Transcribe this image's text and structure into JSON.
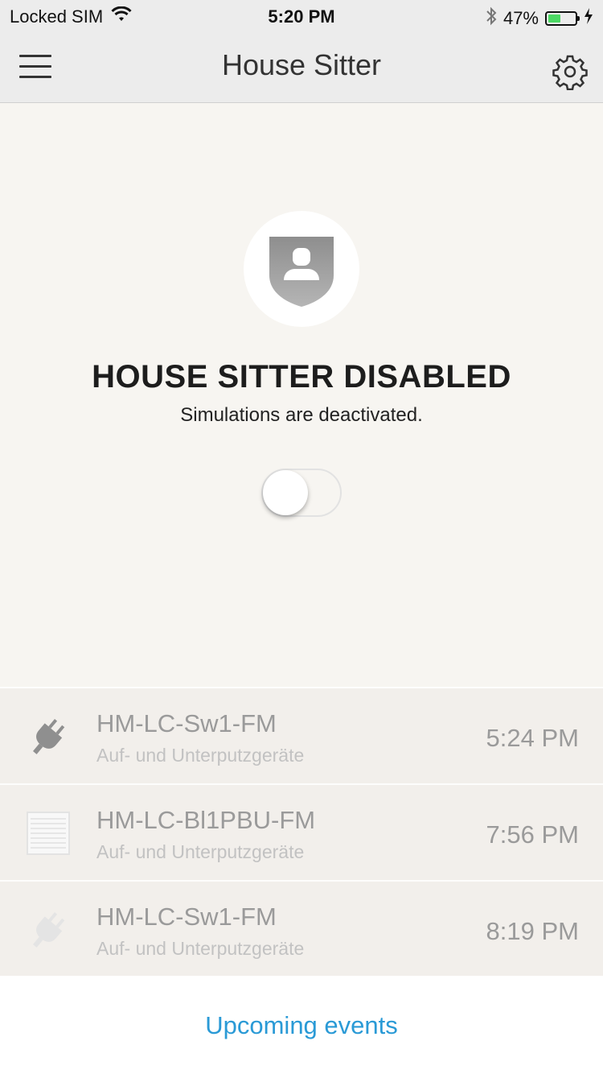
{
  "status_bar": {
    "carrier": "Locked SIM",
    "time": "5:20 PM",
    "battery_percent": "47%",
    "battery_level": 0.47,
    "icons": [
      "wifi-icon",
      "bluetooth-icon",
      "battery-icon",
      "charging-icon"
    ]
  },
  "nav": {
    "title": "House Sitter",
    "menu_icon": "hamburger-icon",
    "settings_icon": "gear-icon"
  },
  "hero": {
    "icon": "shield-person-icon",
    "title": "HOUSE SITTER DISABLED",
    "subtitle": "Simulations are deactivated.",
    "toggle_on": false
  },
  "events": [
    {
      "name": "HM-LC-Sw1-FM",
      "type": "Auf- und Unterputzgeräte",
      "time": "5:24 PM",
      "icon": "plug-icon"
    },
    {
      "name": "HM-LC-Bl1PBU-FM",
      "type": "Auf- und Unterputzgeräte",
      "time": "7:56 PM",
      "icon": "blinds-icon"
    },
    {
      "name": "HM-LC-Sw1-FM",
      "type": "Auf- und Unterputzgeräte",
      "time": "8:19 PM",
      "icon": "plug-icon"
    }
  ],
  "footer": {
    "link_label": "Upcoming events"
  },
  "colors": {
    "accent": "#2a9ad6",
    "battery": "#4cd964",
    "background": "#f7f5f1"
  }
}
